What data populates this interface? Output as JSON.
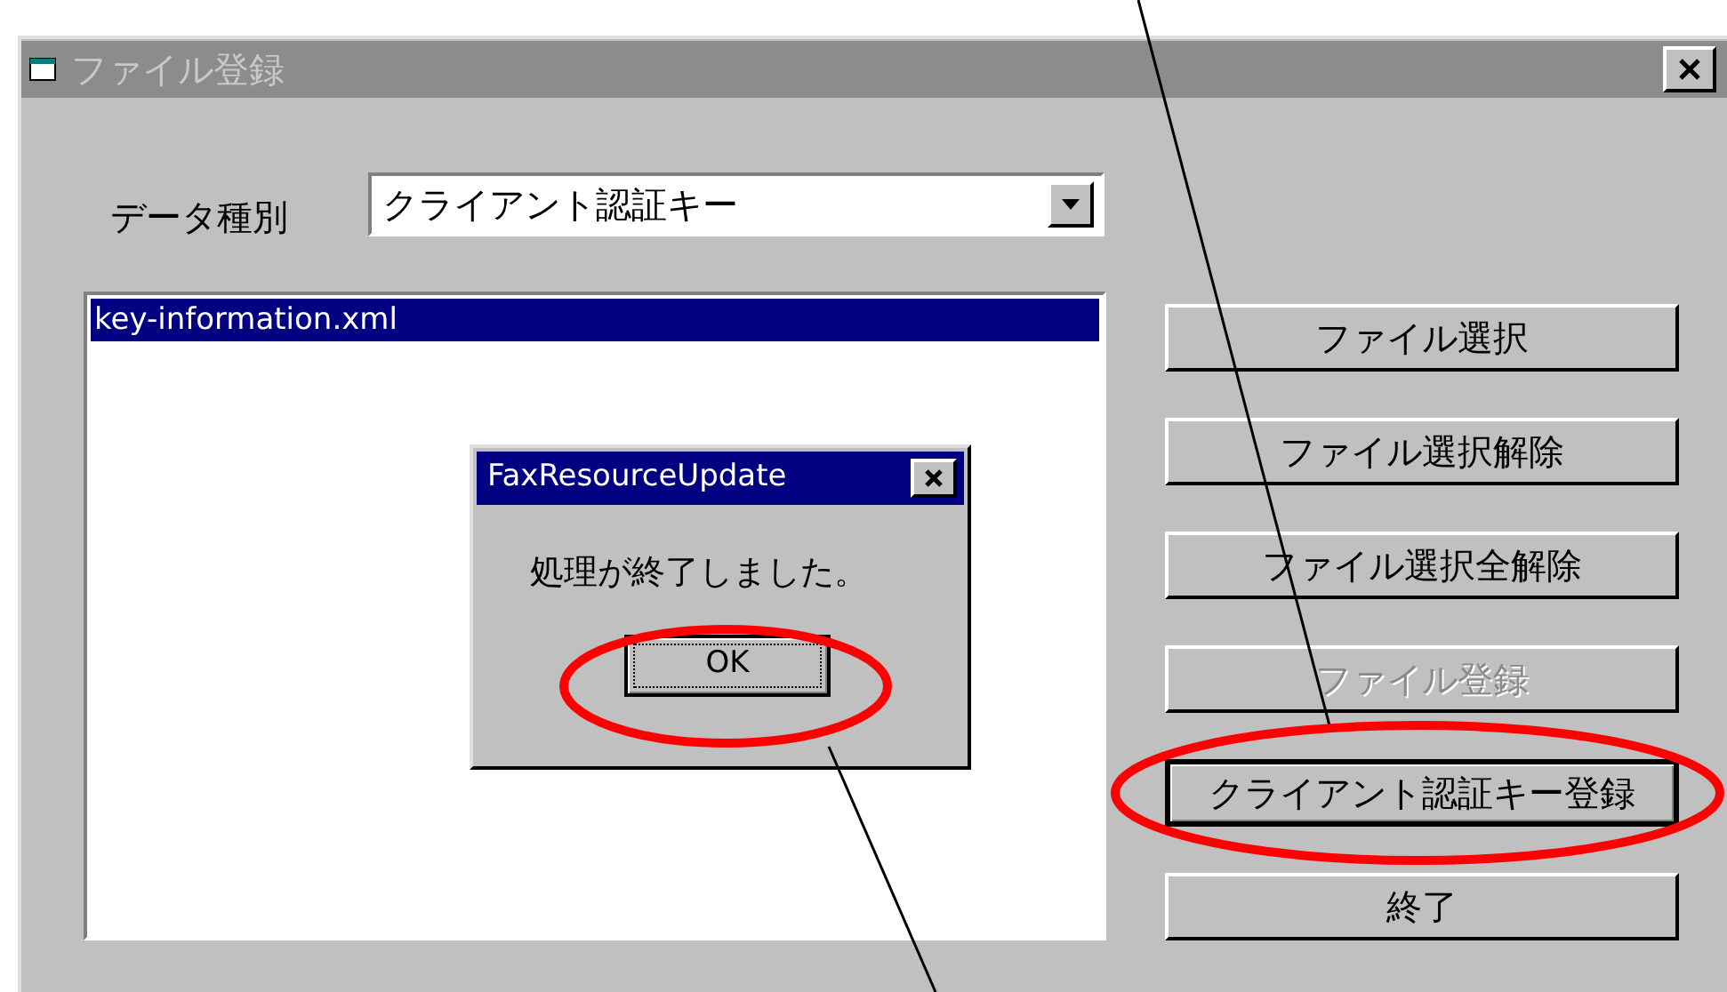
{
  "window": {
    "title": "ファイル登録",
    "active": false
  },
  "data_type": {
    "label": "データ種別",
    "value": "クライアント認証キー"
  },
  "file_list": {
    "items": [
      {
        "text": "key-information.xml",
        "selected": true
      }
    ]
  },
  "buttons": [
    {
      "label": "ファイル選択",
      "disabled": false,
      "default": false
    },
    {
      "label": "ファイル選択解除",
      "disabled": false,
      "default": false
    },
    {
      "label": "ファイル選択全解除",
      "disabled": false,
      "default": false
    },
    {
      "label": "ファイル登録",
      "disabled": true,
      "default": false
    },
    {
      "label": "クライアント認証キー登録",
      "disabled": false,
      "default": true
    },
    {
      "label": "終了",
      "disabled": false,
      "default": false
    }
  ],
  "message_box": {
    "title": "FaxResourceUpdate",
    "message": "処理が終了しました。",
    "buttons": [
      {
        "label": "OK",
        "focused": true
      }
    ]
  }
}
